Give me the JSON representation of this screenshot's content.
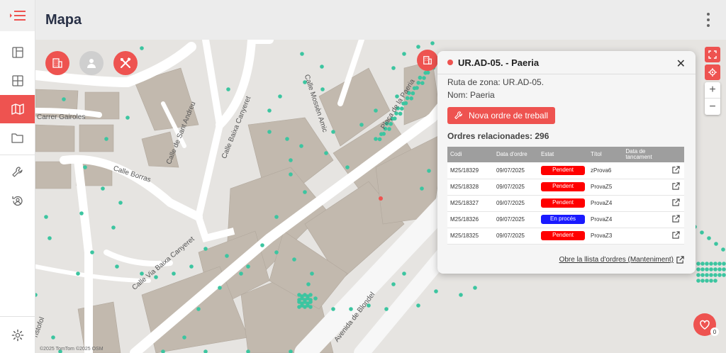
{
  "header": {
    "title": "Mapa"
  },
  "sidebar": {
    "items": [
      {
        "name": "layout-icon"
      },
      {
        "name": "grid-icon"
      },
      {
        "name": "map-icon",
        "active": true
      },
      {
        "name": "folder-icon"
      },
      {
        "name": "wrench-icon"
      },
      {
        "name": "user-history-icon"
      }
    ],
    "settings": "gear-icon"
  },
  "map": {
    "streets": [
      "Carrer Gairoles",
      "Calle de Sant Andreu",
      "Calle Baixa Canyeret",
      "Calle Mossèn Amic",
      "Calle Borras",
      "Plaça de la Paeria",
      "Calle Via Baixa Canyeret",
      "Avenida de Blondel",
      "ristofol"
    ],
    "attribution": "©2025 TomTom ©2025 OSM",
    "notification_count": "0"
  },
  "popup": {
    "title": "UR.AD-05. - Paeria",
    "ruta_label": "Ruta de zona: UR.AD-05.",
    "nom_label": "Nom: Paeria",
    "new_order_button": "Nova ordre de treball",
    "orders_count": "Ordres relacionades: 296",
    "columns": [
      "Codi",
      "Data d'ordre",
      "Estat",
      "Títol",
      "Data de tancament",
      ""
    ],
    "rows": [
      {
        "code": "M25/18329",
        "date": "09/07/2025",
        "status": "Pendent",
        "title": "zProva6",
        "close": ""
      },
      {
        "code": "M25/18328",
        "date": "09/07/2025",
        "status": "Pendent",
        "title": "ProvaZ5",
        "close": ""
      },
      {
        "code": "M25/18327",
        "date": "09/07/2025",
        "status": "Pendent",
        "title": "ProvaZ4",
        "close": ""
      },
      {
        "code": "M25/18326",
        "date": "09/07/2025",
        "status": "En procés",
        "title": "ProvaZ4",
        "close": ""
      },
      {
        "code": "M25/18325",
        "date": "09/07/2025",
        "status": "Pendent",
        "title": "ProvaZ3",
        "close": ""
      }
    ],
    "footer_link": "Obre la llista d'ordres (Manteniment)"
  },
  "colors": {
    "accent": "#ee5350",
    "pending": "#ff0000",
    "process": "#1a1aff",
    "marker": "#3cc5a0"
  }
}
